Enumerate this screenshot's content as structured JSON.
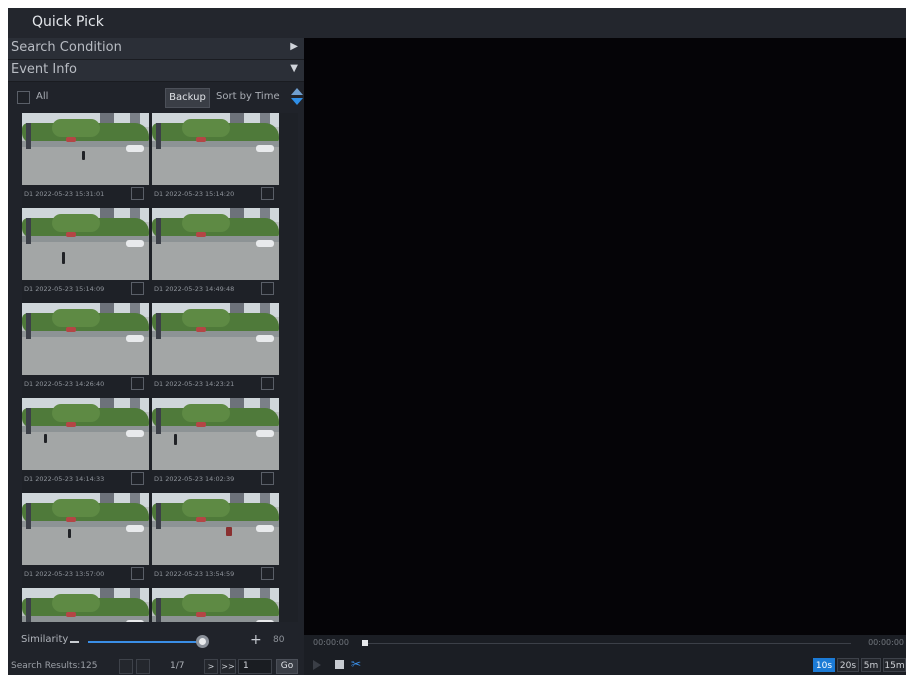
{
  "window": {
    "title": "Quick Pick"
  },
  "sections": {
    "search_condition": "Search Condition",
    "event_info": "Event Info"
  },
  "toolbar": {
    "all_label": "All",
    "backup_label": "Backup",
    "sort_label": "Sort by Time"
  },
  "thumbnails": [
    {
      "label": "D1 2022-05-23 15:31:01"
    },
    {
      "label": "D1 2022-05-23 15:14:20"
    },
    {
      "label": "D1 2022-05-23 15:14:09"
    },
    {
      "label": "D1 2022-05-23 14:49:48"
    },
    {
      "label": "D1 2022-05-23 14:26:40"
    },
    {
      "label": "D1 2022-05-23 14:23:21"
    },
    {
      "label": "D1 2022-05-23 14:14:33"
    },
    {
      "label": "D1 2022-05-23 14:02:39"
    },
    {
      "label": "D1 2022-05-23 13:57:00"
    },
    {
      "label": "D1 2022-05-23 13:54:59"
    },
    {
      "label": ""
    },
    {
      "label": ""
    }
  ],
  "similarity": {
    "label": "Similarity",
    "value": "80",
    "minus": "−",
    "plus": "+"
  },
  "pager": {
    "results": "Search Results:125",
    "first": "",
    "prev": "",
    "page_info": "1/7",
    "next": ">",
    "last": ">>",
    "page_input": "1",
    "go": "Go"
  },
  "timeline": {
    "start": "00:00:00",
    "end": "00:00:00",
    "zoom_options": [
      "10s",
      "20s",
      "5m",
      "15m"
    ],
    "selected_zoom": "10s"
  },
  "icons": {
    "section_collapsed": "chevron-right-icon",
    "section_expanded": "chevron-down-icon",
    "sort": "sort-updown-icon",
    "play": "play-icon",
    "stop": "stop-icon",
    "clip": "clip-icon"
  },
  "colors": {
    "accent": "#1c7bd6",
    "background": "#1b1e24",
    "video": "#050407"
  }
}
